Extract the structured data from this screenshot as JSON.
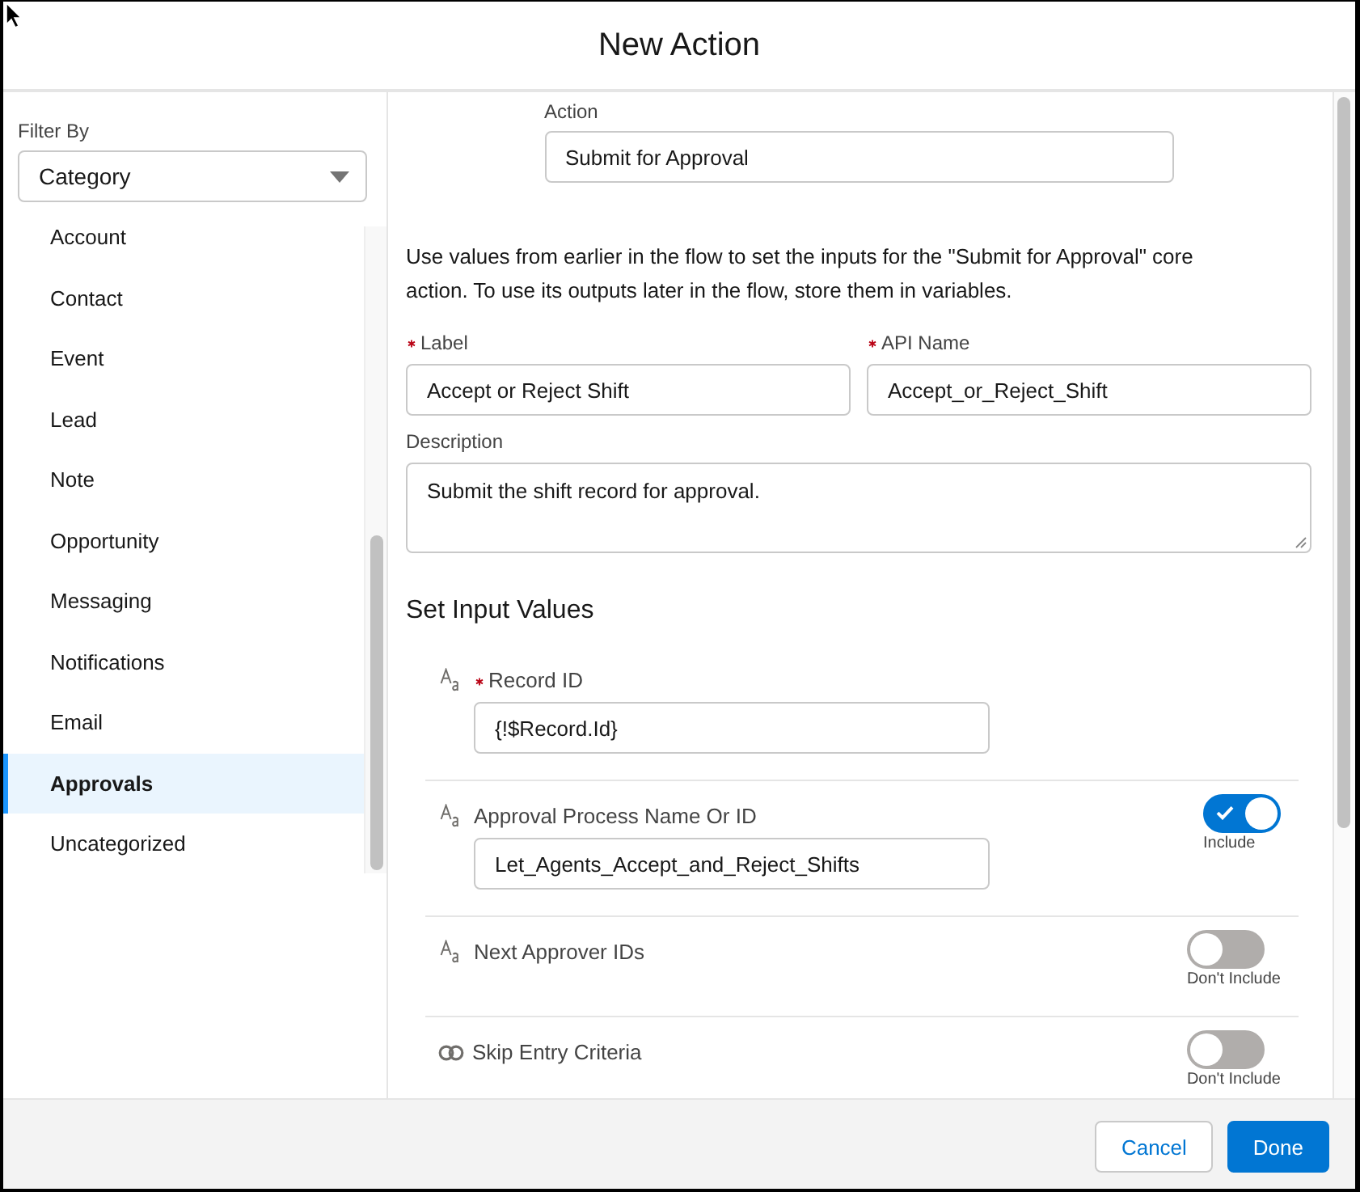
{
  "dialog": {
    "title": "New Action"
  },
  "sidebar": {
    "filter": {
      "label": "Filter By",
      "value": "Category"
    },
    "items": [
      {
        "label": "Account",
        "selected": false
      },
      {
        "label": "Contact",
        "selected": false
      },
      {
        "label": "Event",
        "selected": false
      },
      {
        "label": "Lead",
        "selected": false
      },
      {
        "label": "Note",
        "selected": false
      },
      {
        "label": "Opportunity",
        "selected": false
      },
      {
        "label": "Messaging",
        "selected": false
      },
      {
        "label": "Notifications",
        "selected": false
      },
      {
        "label": "Email",
        "selected": false
      },
      {
        "label": "Approvals",
        "selected": true
      },
      {
        "label": "Uncategorized",
        "selected": false
      }
    ]
  },
  "action": {
    "label": "Action",
    "value": "Submit for Approval"
  },
  "intro": "Use values from earlier in the flow to set the inputs for the \"Submit for Approval\" core action. To use its outputs later in the flow, store them in variables.",
  "fields": [
    {
      "label": "Label",
      "required": true,
      "value": "Accept or Reject Shift"
    },
    {
      "label": "API Name",
      "required": true,
      "value": "Accept_or_Reject_Shift"
    }
  ],
  "description": {
    "label": "Description",
    "value": "Submit the shift record for approval."
  },
  "input_values": {
    "heading": "Set Input Values",
    "items": [
      {
        "kind": "text",
        "label": "Record ID",
        "required": true,
        "value": "{!$Record.Id}"
      },
      {
        "kind": "text",
        "label": "Approval Process Name Or ID",
        "required": false,
        "value": "Let_Agents_Accept_and_Reject_Shifts",
        "toggle": {
          "on": true,
          "caption": "Include"
        }
      },
      {
        "kind": "text",
        "label": "Next Approver IDs",
        "required": false,
        "toggle": {
          "on": false,
          "caption": "Don't Include"
        }
      },
      {
        "kind": "boolean",
        "label": "Skip Entry Criteria",
        "required": false,
        "toggle": {
          "on": false,
          "caption": "Don't Include"
        }
      }
    ]
  },
  "buttons": [
    {
      "label": "Cancel",
      "kind": "neutral"
    },
    {
      "label": "Done",
      "kind": "brand"
    }
  ]
}
